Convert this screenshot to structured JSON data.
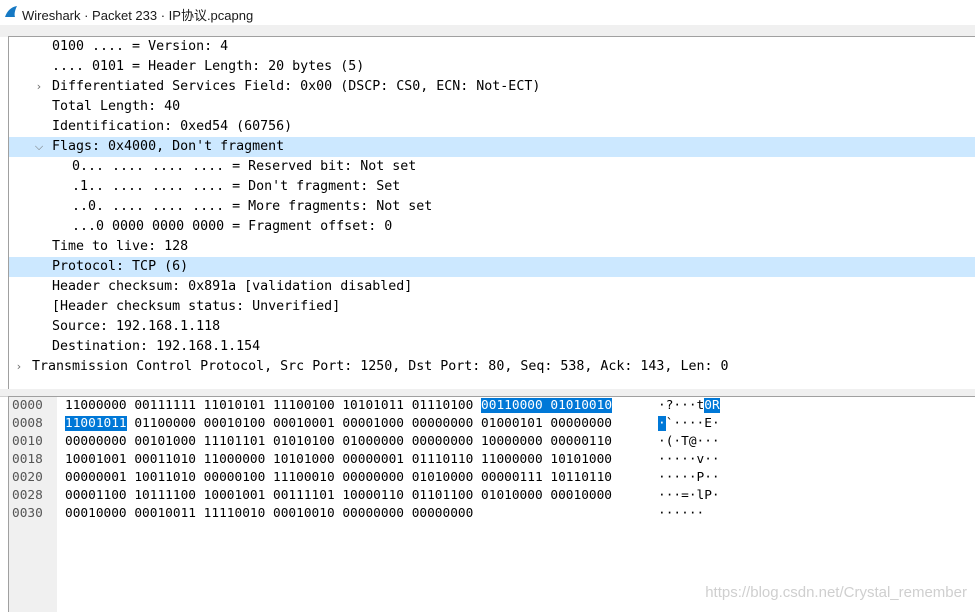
{
  "window": {
    "title": "Wireshark · Packet 233 · IP协议.pcapng",
    "app_icon": "wireshark-fin-icon"
  },
  "tree": [
    {
      "text": "0100 .... = Version: 4"
    },
    {
      "text": ".... 0101 = Header Length: 20 bytes (5)"
    },
    {
      "text": "Differentiated Services Field: 0x00 (DSCP: CS0, ECN: Not-ECT)"
    },
    {
      "text": "Total Length: 40"
    },
    {
      "text": "Identification: 0xed54 (60756)"
    },
    {
      "text": "Flags: 0x4000, Don't fragment"
    },
    {
      "text": "0... .... .... .... = Reserved bit: Not set"
    },
    {
      "text": ".1.. .... .... .... = Don't fragment: Set"
    },
    {
      "text": "..0. .... .... .... = More fragments: Not set"
    },
    {
      "text": "...0 0000 0000 0000 = Fragment offset: 0"
    },
    {
      "text": "Time to live: 128"
    },
    {
      "text": "Protocol: TCP (6)"
    },
    {
      "text": "Header checksum: 0x891a [validation disabled]"
    },
    {
      "text": "[Header checksum status: Unverified]"
    },
    {
      "text": "Source: 192.168.1.118"
    },
    {
      "text": "Destination: 192.168.1.154"
    },
    {
      "text": "Transmission Control Protocol, Src Port: 1250, Dst Port: 80, Seq: 538, Ack: 143, Len: 0"
    }
  ],
  "bytes": [
    {
      "offset": "0000",
      "bits_a": "11000000 00111111 11010101 11100100 10101011 01110100 ",
      "bits_sel": "00110000 01010010",
      "bits_b": "",
      "ascii_a": "·?···t",
      "ascii_sel": "0R",
      "ascii_b": ""
    },
    {
      "offset": "0008",
      "bits_a": "",
      "bits_sel": "11001011",
      "bits_b": " 01100000 00010100 00010001 00001000 00000000 01000101 00000000",
      "ascii_a": "",
      "ascii_sel": "·",
      "ascii_b": "`····E·"
    },
    {
      "offset": "0010",
      "bits_a": "00000000 00101000 11101101 01010100 01000000 00000000 10000000 00000110",
      "bits_sel": "",
      "bits_b": "",
      "ascii_a": "·(·T@···",
      "ascii_sel": "",
      "ascii_b": ""
    },
    {
      "offset": "0018",
      "bits_a": "10001001 00011010 11000000 10101000 00000001 01110110 11000000 10101000",
      "bits_sel": "",
      "bits_b": "",
      "ascii_a": "·····v··",
      "ascii_sel": "",
      "ascii_b": ""
    },
    {
      "offset": "0020",
      "bits_a": "00000001 10011010 00000100 11100010 00000000 01010000 00000111 10110110",
      "bits_sel": "",
      "bits_b": "",
      "ascii_a": "·····P··",
      "ascii_sel": "",
      "ascii_b": ""
    },
    {
      "offset": "0028",
      "bits_a": "00001100 10111100 10001001 00111101 10000110 01101100 01010000 00010000",
      "bits_sel": "",
      "bits_b": "",
      "ascii_a": "···=·lP·",
      "ascii_sel": "",
      "ascii_b": ""
    },
    {
      "offset": "0030",
      "bits_a": "00010000 00010011 11110010 00010010 00000000 00000000",
      "bits_sel": "",
      "bits_b": "",
      "ascii_a": "······",
      "ascii_sel": "",
      "ascii_b": ""
    }
  ],
  "watermark": "https://blog.csdn.net/Crystal_remember",
  "colors": {
    "selection": "#0078d7",
    "row_highlight": "#cce8ff",
    "offset_gutter": "#f0f0f0"
  }
}
